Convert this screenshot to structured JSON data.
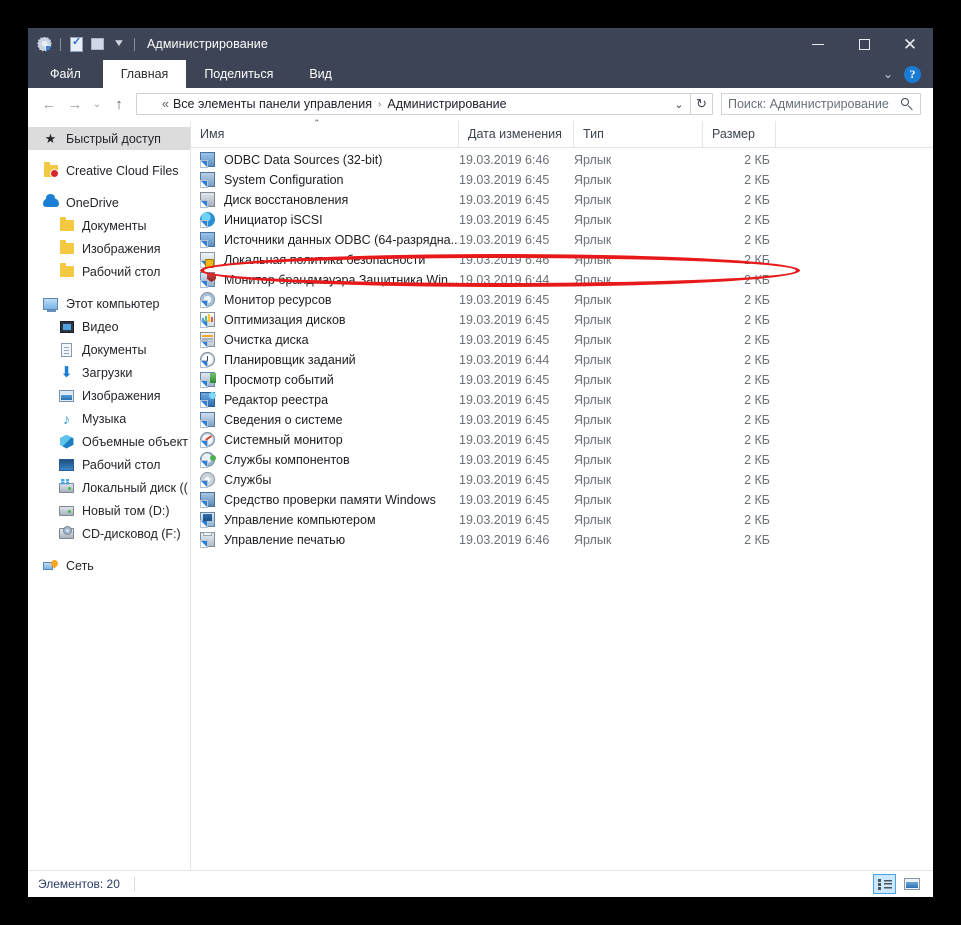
{
  "window": {
    "title": "Администрирование",
    "controls": {
      "minimize": "—",
      "maximize": "□",
      "close": "✕"
    }
  },
  "ribbon": {
    "tabs": [
      {
        "label": "Файл",
        "active": false,
        "style": "file"
      },
      {
        "label": "Главная",
        "active": true,
        "style": "normal"
      },
      {
        "label": "Поделиться",
        "active": false,
        "style": "normal"
      },
      {
        "label": "Вид",
        "active": false,
        "style": "normal"
      }
    ],
    "help_label": "?"
  },
  "address": {
    "back": "←",
    "forward": "→",
    "history": "⌄",
    "up": "↑",
    "crumb_prefix": "«",
    "crumbs": [
      "Все элементы панели управления",
      "Администрирование"
    ],
    "separator": "›",
    "dropdown": "⌄",
    "refresh": "↻"
  },
  "search": {
    "placeholder": "Поиск: Администрирование"
  },
  "sidebar": {
    "items": [
      {
        "label": "Быстрый доступ",
        "icon": "star-icon",
        "selected": true,
        "indent": false,
        "gap_before": false
      },
      {
        "label": "Creative Cloud Files",
        "icon": "creative-cloud-icon",
        "selected": false,
        "indent": false,
        "gap_before": true
      },
      {
        "label": "OneDrive",
        "icon": "cloud-icon",
        "selected": false,
        "indent": false,
        "gap_before": true
      },
      {
        "label": "Документы",
        "icon": "folder-icon",
        "selected": false,
        "indent": true,
        "gap_before": false
      },
      {
        "label": "Изображения",
        "icon": "folder-icon",
        "selected": false,
        "indent": true,
        "gap_before": false
      },
      {
        "label": "Рабочий стол",
        "icon": "folder-icon",
        "selected": false,
        "indent": true,
        "gap_before": false
      },
      {
        "label": "Этот компьютер",
        "icon": "this-pc-icon",
        "selected": false,
        "indent": false,
        "gap_before": true
      },
      {
        "label": "Видео",
        "icon": "video-icon",
        "selected": false,
        "indent": true,
        "gap_before": false
      },
      {
        "label": "Документы",
        "icon": "documents-icon",
        "selected": false,
        "indent": true,
        "gap_before": false
      },
      {
        "label": "Загрузки",
        "icon": "downloads-icon",
        "selected": false,
        "indent": true,
        "gap_before": false
      },
      {
        "label": "Изображения",
        "icon": "pictures-icon",
        "selected": false,
        "indent": true,
        "gap_before": false
      },
      {
        "label": "Музыка",
        "icon": "music-icon",
        "selected": false,
        "indent": true,
        "gap_before": false
      },
      {
        "label": "Объемные объект",
        "icon": "3d-objects-icon",
        "selected": false,
        "indent": true,
        "gap_before": false
      },
      {
        "label": "Рабочий стол",
        "icon": "desktop-icon",
        "selected": false,
        "indent": true,
        "gap_before": false
      },
      {
        "label": "Локальный диск ((",
        "icon": "local-disk-icon",
        "selected": false,
        "indent": true,
        "gap_before": false
      },
      {
        "label": "Новый том (D:)",
        "icon": "drive-icon",
        "selected": false,
        "indent": true,
        "gap_before": false
      },
      {
        "label": "CD-дисковод (F:)",
        "icon": "cd-drive-icon",
        "selected": false,
        "indent": true,
        "gap_before": false
      },
      {
        "label": "Сеть",
        "icon": "network-icon",
        "selected": false,
        "indent": false,
        "gap_before": true
      }
    ]
  },
  "file_list": {
    "sort_indicator": "⌃",
    "columns": [
      {
        "key": "name",
        "label": "Имя"
      },
      {
        "key": "date",
        "label": "Дата изменения"
      },
      {
        "key": "type",
        "label": "Тип"
      },
      {
        "key": "size",
        "label": "Размер"
      }
    ],
    "rows": [
      {
        "name": "ODBC Data Sources (32-bit)",
        "date": "19.03.2019 6:46",
        "type": "Ярлык",
        "size": "2 КБ",
        "icon": "odbc-shortcut-icon",
        "highlighted": false
      },
      {
        "name": "System Configuration",
        "date": "19.03.2019 6:45",
        "type": "Ярлык",
        "size": "2 КБ",
        "icon": "system-configuration-shortcut-icon",
        "highlighted": false
      },
      {
        "name": "Диск восстановления",
        "date": "19.03.2019 6:45",
        "type": "Ярлык",
        "size": "2 КБ",
        "icon": "recovery-drive-shortcut-icon",
        "highlighted": false
      },
      {
        "name": "Инициатор iSCSI",
        "date": "19.03.2019 6:45",
        "type": "Ярлык",
        "size": "2 КБ",
        "icon": "iscsi-initiator-shortcut-icon",
        "highlighted": false
      },
      {
        "name": "Источники данных ODBC (64-разрядна...",
        "date": "19.03.2019 6:45",
        "type": "Ярлык",
        "size": "2 КБ",
        "icon": "odbc64-shortcut-icon",
        "highlighted": false
      },
      {
        "name": "Локальная политика безопасности",
        "date": "19.03.2019 6:46",
        "type": "Ярлык",
        "size": "2 КБ",
        "icon": "local-security-policy-shortcut-icon",
        "highlighted": true
      },
      {
        "name": "Монитор брандмауэра Защитника Win...",
        "date": "19.03.2019 6:44",
        "type": "Ярлык",
        "size": "2 КБ",
        "icon": "firewall-monitor-shortcut-icon",
        "highlighted": false
      },
      {
        "name": "Монитор ресурсов",
        "date": "19.03.2019 6:45",
        "type": "Ярлык",
        "size": "2 КБ",
        "icon": "resource-monitor-shortcut-icon",
        "highlighted": false
      },
      {
        "name": "Оптимизация дисков",
        "date": "19.03.2019 6:45",
        "type": "Ярлык",
        "size": "2 КБ",
        "icon": "defrag-shortcut-icon",
        "highlighted": false
      },
      {
        "name": "Очистка диска",
        "date": "19.03.2019 6:45",
        "type": "Ярлык",
        "size": "2 КБ",
        "icon": "disk-cleanup-shortcut-icon",
        "highlighted": false
      },
      {
        "name": "Планировщик заданий",
        "date": "19.03.2019 6:44",
        "type": "Ярлык",
        "size": "2 КБ",
        "icon": "task-scheduler-shortcut-icon",
        "highlighted": false
      },
      {
        "name": "Просмотр событий",
        "date": "19.03.2019 6:45",
        "type": "Ярлык",
        "size": "2 КБ",
        "icon": "event-viewer-shortcut-icon",
        "highlighted": false
      },
      {
        "name": "Редактор реестра",
        "date": "19.03.2019 6:45",
        "type": "Ярлык",
        "size": "2 КБ",
        "icon": "registry-editor-shortcut-icon",
        "highlighted": false
      },
      {
        "name": "Сведения о системе",
        "date": "19.03.2019 6:45",
        "type": "Ярлык",
        "size": "2 КБ",
        "icon": "system-information-shortcut-icon",
        "highlighted": false
      },
      {
        "name": "Системный монитор",
        "date": "19.03.2019 6:45",
        "type": "Ярлык",
        "size": "2 КБ",
        "icon": "performance-monitor-shortcut-icon",
        "highlighted": false
      },
      {
        "name": "Службы компонентов",
        "date": "19.03.2019 6:45",
        "type": "Ярлык",
        "size": "2 КБ",
        "icon": "component-services-shortcut-icon",
        "highlighted": false
      },
      {
        "name": "Службы",
        "date": "19.03.2019 6:45",
        "type": "Ярлык",
        "size": "2 КБ",
        "icon": "services-shortcut-icon",
        "highlighted": false
      },
      {
        "name": "Средство проверки памяти Windows",
        "date": "19.03.2019 6:45",
        "type": "Ярлык",
        "size": "2 КБ",
        "icon": "memory-diagnostic-shortcut-icon",
        "highlighted": false
      },
      {
        "name": "Управление компьютером",
        "date": "19.03.2019 6:45",
        "type": "Ярлык",
        "size": "2 КБ",
        "icon": "computer-management-shortcut-icon",
        "highlighted": false
      },
      {
        "name": "Управление печатью",
        "date": "19.03.2019 6:46",
        "type": "Ярлык",
        "size": "2 КБ",
        "icon": "print-management-shortcut-icon",
        "highlighted": false
      }
    ]
  },
  "status": {
    "items_label": "Элементов: 20",
    "details_view": "details-view-button",
    "tiles_view": "tiles-view-button"
  },
  "annotation": {
    "color": "#e8191a",
    "target_row": "Локальная политика безопасности"
  }
}
